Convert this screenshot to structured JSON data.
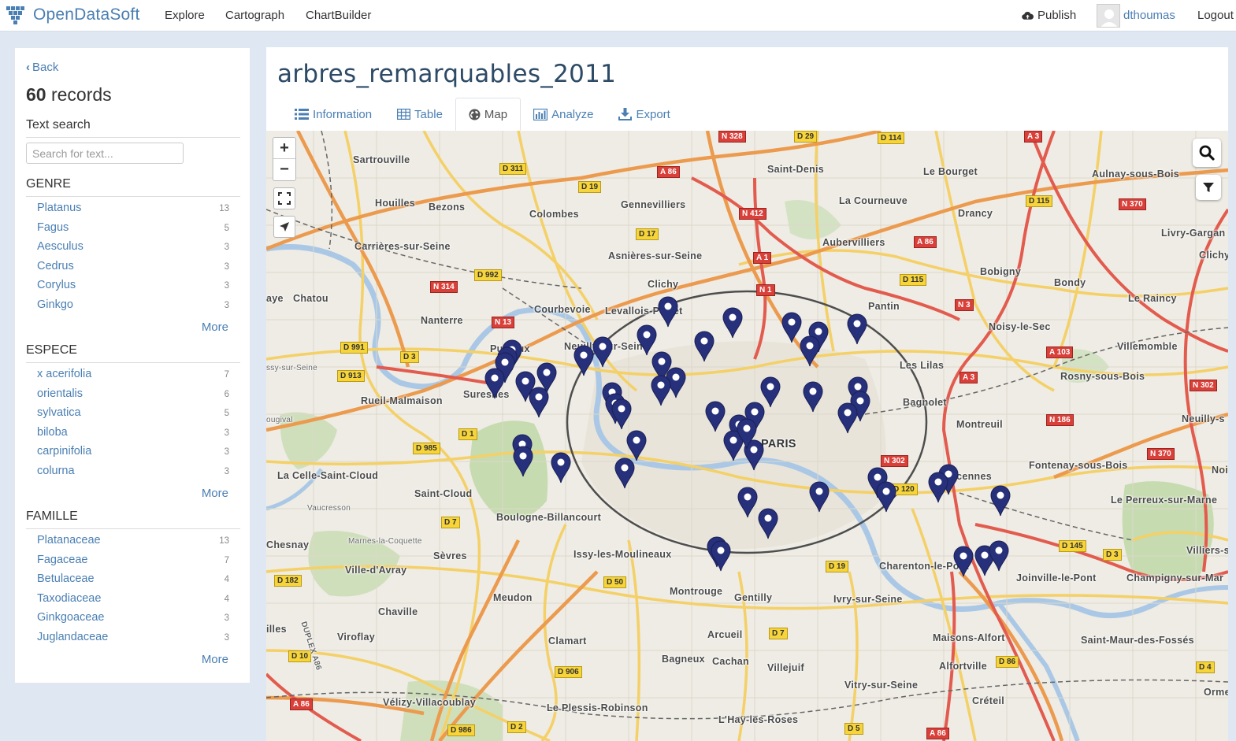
{
  "brand": {
    "name": "OpenDataSoft"
  },
  "nav": {
    "explore": "Explore",
    "cartograph": "Cartograph",
    "chartbuilder": "ChartBuilder"
  },
  "user": {
    "publish": "Publish",
    "username": "dthoumas",
    "logout": "Logout"
  },
  "sidebar": {
    "back": "Back",
    "records_count": "60",
    "records_label": "records",
    "text_search": {
      "title": "Text search",
      "placeholder": "Search for text..."
    },
    "facets": [
      {
        "title": "GENRE",
        "more": "More",
        "items": [
          {
            "label": "Platanus",
            "count": "13"
          },
          {
            "label": "Fagus",
            "count": "5"
          },
          {
            "label": "Aesculus",
            "count": "3"
          },
          {
            "label": "Cedrus",
            "count": "3"
          },
          {
            "label": "Corylus",
            "count": "3"
          },
          {
            "label": "Ginkgo",
            "count": "3"
          }
        ]
      },
      {
        "title": "ESPECE",
        "more": "More",
        "items": [
          {
            "label": "x acerifolia",
            "count": "7"
          },
          {
            "label": "orientalis",
            "count": "6"
          },
          {
            "label": "sylvatica",
            "count": "5"
          },
          {
            "label": "biloba",
            "count": "3"
          },
          {
            "label": "carpinifolia",
            "count": "3"
          },
          {
            "label": "colurna",
            "count": "3"
          }
        ]
      },
      {
        "title": "FAMILLE",
        "more": "More",
        "items": [
          {
            "label": "Platanaceae",
            "count": "13"
          },
          {
            "label": "Fagaceae",
            "count": "7"
          },
          {
            "label": "Betulaceae",
            "count": "4"
          },
          {
            "label": "Taxodiaceae",
            "count": "4"
          },
          {
            "label": "Ginkgoaceae",
            "count": "3"
          },
          {
            "label": "Juglandaceae",
            "count": "3"
          }
        ]
      }
    ]
  },
  "dataset": {
    "title": "arbres_remarquables_2011"
  },
  "tabs": {
    "information": "Information",
    "table": "Table",
    "map": "Map",
    "analyze": "Analyze",
    "export": "Export",
    "active": "Map"
  },
  "map": {
    "zoom_in": "+",
    "zoom_out": "−",
    "places": {
      "sartrouville": "Sartrouville",
      "houilles": "Houilles",
      "bezons": "Bezons",
      "colombes": "Colombes",
      "gennevilliers": "Gennevilliers",
      "saint_denis": "Saint-Denis",
      "le_bourget": "Le Bourget",
      "aulnay": "Aulnay-sous-Bois",
      "la_courneuve": "La Courneuve",
      "drancy": "Drancy",
      "livry": "Livry-Gargan",
      "clichy_sb": "Clichy",
      "carrieres": "Carrières-sur-Seine",
      "asnieres": "Asnières-sur-Seine",
      "aubervilliers": "Aubervilliers",
      "bobigny": "Bobigny",
      "bondy": "Bondy",
      "le_raincy": "Le Raincy",
      "chatou": "Chatou",
      "clichy": "Clichy",
      "courbevoie": "Courbevoie",
      "levallois": "Levallois-Perret",
      "pantin": "Pantin",
      "nanterre": "Nanterre",
      "noisy": "Noisy-le-Sec",
      "puteaux": "Puteaux",
      "neuilly": "Neuilly-sur-Seine",
      "villemomble": "Villemomble",
      "les_lilas": "Les Lilas",
      "rosny": "Rosny-sous-Bois",
      "rueil": "Rueil-Malmaison",
      "suresnes": "Suresnes",
      "bagnolet": "Bagnolet",
      "montreuil": "Montreuil",
      "neuilly_s": "Neuilly-s",
      "paris": "PARIS",
      "la_celle": "La Celle-Saint-Cloud",
      "saint_cloud": "Saint-Cloud",
      "fontenay": "Fontenay-sous-Bois",
      "vincennes": "Vincennes",
      "noi": "Noi",
      "le_perreux": "Le Perreux-sur-Marne",
      "boulogne": "Boulogne-Billancourt",
      "chesnay": "Chesnay",
      "sevres": "Sèvres",
      "issy": "Issy-les-Moulineaux",
      "villiers": "Villiers-s",
      "ville_davray": "Ville-d'Avray",
      "charenton": "Charenton-le-Pont",
      "joinville": "Joinville-le-Pont",
      "champigny": "Champigny-sur-Mar",
      "montrouge": "Montrouge",
      "gentilly": "Gentilly",
      "meudon": "Meudon",
      "ivry": "Ivry-sur-Seine",
      "chaville": "Chaville",
      "arcueil": "Arcueil",
      "maisons_alfort": "Maisons-Alfort",
      "saint_maur": "Saint-Maur-des-Fossés",
      "illes": "illes",
      "viroflay": "Viroflay",
      "clamart": "Clamart",
      "bagneux": "Bagneux",
      "cachan": "Cachan",
      "villejuif": "Villejuif",
      "alfortville": "Alfortville",
      "orme": "Orme",
      "vitry": "Vitry-sur-Seine",
      "velizy": "Vélizy-Villacoublay",
      "creteil": "Créteil",
      "plessis": "Le Plessis-Robinson",
      "lhay": "L'Haÿ-les-Roses",
      "vaucresson": "Vaucresson",
      "marnes": "Marnes-la-Coquette",
      "ougival": "ougival",
      "ssy_sur_seine": "ssy-sur-Seine",
      "aye": "aye",
      "duplex": "DUPLEX A86"
    },
    "roads": [
      "N 328",
      "D 29",
      "D 114",
      "A 3",
      "D 311",
      "A 86",
      "D 19",
      "N 412",
      "D 17",
      "D 115",
      "N 370",
      "A 86",
      "A 1",
      "D 992",
      "N 314",
      "N 1",
      "D 115",
      "N 3",
      "N 13",
      "D 991",
      "D 3",
      "A 103",
      "D 913",
      "A 3",
      "N 302",
      "N 186",
      "D 1",
      "D 985",
      "N 302",
      "N 370",
      "D 120",
      "D 7",
      "D 145",
      "D 3",
      "D 182",
      "D 19",
      "D 50",
      "D 7",
      "D 10",
      "D 86",
      "D 4",
      "D 906",
      "A 86",
      "D 986",
      "D 2",
      "D 5",
      "A 86"
    ],
    "marker_color": "#27307a"
  }
}
